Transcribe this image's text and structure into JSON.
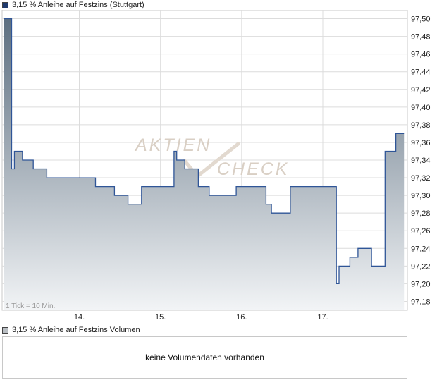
{
  "legend": {
    "price_label": "3,15 % Anleihe auf Festzins (Stuttgart)",
    "volume_label": "3,15 % Anleihe auf Festzins Volumen"
  },
  "volume": {
    "message": "keine Volumendaten vorhanden"
  },
  "watermark": {
    "line1": "AKTIEN",
    "line2": "CHECK"
  },
  "tick_note": "1 Tick = 10 Min.",
  "colors": {
    "line": "#2f5597",
    "area_top": "#5d6f80",
    "area_bottom": "#f2f4f6",
    "grid": "#dcdcdc",
    "watermark": "#d9cfc4"
  },
  "chart_data": {
    "type": "area",
    "title": "3,15 % Anleihe auf Festzins (Stuttgart)",
    "xlabel": "",
    "ylabel": "",
    "x_tick_labels": [
      "14.",
      "15.",
      "16.",
      "17."
    ],
    "x_tick_index": [
      28,
      58,
      88,
      118
    ],
    "x_count": 150,
    "y_ticks": [
      "97,18",
      "97,20",
      "97,22",
      "97,24",
      "97,26",
      "97,28",
      "97,30",
      "97,32",
      "97,34",
      "97,36",
      "97,38",
      "97,40",
      "97,42",
      "97,44",
      "97,46",
      "97,48",
      "97,50"
    ],
    "ylim": [
      97.17,
      97.51
    ],
    "grid": true,
    "legend_position": "top-left",
    "series": [
      {
        "name": "3,15 % Anleihe auf Festzins (Stuttgart)",
        "steps": [
          [
            0,
            97.5
          ],
          [
            3,
            97.33
          ],
          [
            4,
            97.35
          ],
          [
            7,
            97.34
          ],
          [
            11,
            97.33
          ],
          [
            16,
            97.32
          ],
          [
            34,
            97.31
          ],
          [
            41,
            97.3
          ],
          [
            46,
            97.29
          ],
          [
            51,
            97.31
          ],
          [
            63,
            97.35
          ],
          [
            64,
            97.34
          ],
          [
            67,
            97.33
          ],
          [
            72,
            97.31
          ],
          [
            76,
            97.3
          ],
          [
            86,
            97.31
          ],
          [
            97,
            97.29
          ],
          [
            99,
            97.28
          ],
          [
            106,
            97.31
          ],
          [
            123,
            97.2
          ],
          [
            124,
            97.22
          ],
          [
            128,
            97.23
          ],
          [
            131,
            97.24
          ],
          [
            136,
            97.22
          ],
          [
            141,
            97.35
          ],
          [
            145,
            97.37
          ],
          [
            148,
            97.37
          ]
        ]
      }
    ]
  }
}
